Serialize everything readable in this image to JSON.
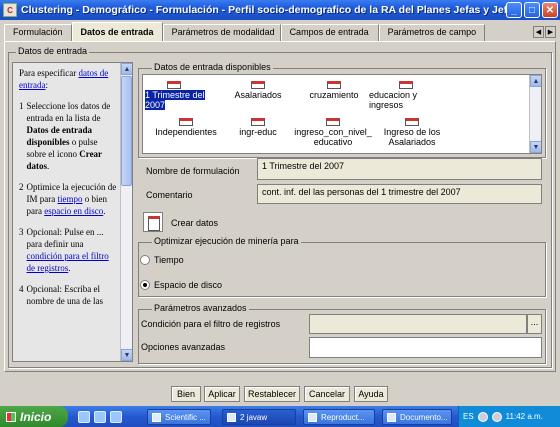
{
  "window": {
    "title": "Clustering - Demográfico - Formulación - Perfil socio-demografico de la RA del Planes Jefas y Jefes"
  },
  "tabs": [
    "Formulación",
    "Datos de entrada",
    "Parámetros de modalidad",
    "Campos de entrada",
    "Parámetros de campo"
  ],
  "active_tab": "Datos de entrada",
  "group_title": "Datos de entrada",
  "help": {
    "p1_pre": "Para especificar ",
    "p1_link": "datos de entrada",
    "p1_post": ":",
    "s1_num": "1",
    "s1_a": "Seleccione los datos de entrada en la lista de ",
    "s1_bold": "Datos de entrada disponibles",
    "s1_b": " o pulse sobre el icono ",
    "s1_bold2": "Crear datos",
    "s1_c": ".",
    "s2_num": "2",
    "s2_a": "Optimice la ejecución de IM para ",
    "s2_link1": "tiempo",
    "s2_b": " o bien para ",
    "s2_link2": "espacio en disco",
    "s2_c": ".",
    "s3_num": "3",
    "s3_a": "Opcional: Pulse en ... para definir una ",
    "s3_link": "condición para el filtro de registros",
    "s3_b": ".",
    "s4_num": "4",
    "s4_a": "Opcional: Escriba el nombre de una de las"
  },
  "available": {
    "title": "Datos de entrada disponibles",
    "items": [
      "1 Trimestre del 2007",
      "Asalariados",
      "cruzamiento",
      "educacion y ingresos",
      "Independientes",
      "ingr-educ",
      "ingreso_con_nivel_educativo",
      "Ingreso de los Asalariados"
    ]
  },
  "form": {
    "name_label": "Nombre de formulación",
    "name_value": "1 Trimestre del 2007",
    "comment_label": "Comentario",
    "comment_value": "cont. inf. del las personas del 1 trimestre del 2007",
    "create_label": "Crear datos"
  },
  "optimize": {
    "title": "Optimizar ejecución de minería para",
    "opt_time": "Tiempo",
    "opt_disk": "Espacio de disco",
    "selected": "Espacio de disco"
  },
  "advanced": {
    "title": "Parámetros avanzados",
    "filter_label": "Condición para el filtro de registros",
    "filter_value": "",
    "browse": "...",
    "options_label": "Opciones avanzadas",
    "options_value": ""
  },
  "buttons": {
    "ok": "Bien",
    "apply": "Aplicar",
    "reset": "Restablecer",
    "cancel": "Cancelar",
    "help": "Ayuda"
  },
  "taskbar": {
    "start": "Inicio",
    "items": [
      "Scientific ...",
      "2 javaw",
      "Reproduct...",
      "Documento..."
    ],
    "lang": "ES",
    "clock": "11:42 a.m."
  }
}
